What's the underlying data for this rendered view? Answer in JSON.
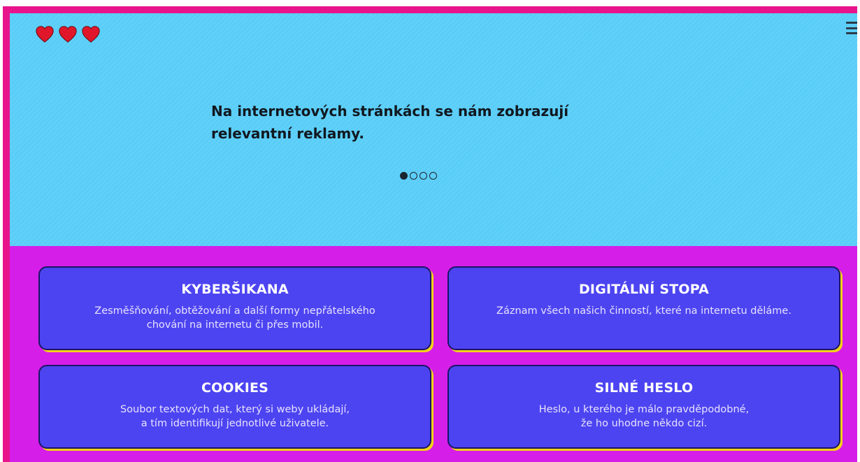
{
  "lives": [
    {
      "icon": "heart-icon",
      "color": "#e0172a"
    },
    {
      "icon": "heart-icon",
      "color": "#e0172a"
    },
    {
      "icon": "heart-icon",
      "color": "#e0172a"
    }
  ],
  "menu": {
    "icon": "hamburger-menu-icon"
  },
  "slide": {
    "lines": [
      "Na internetových stránkách se nám zobrazují",
      "relevantní reklamy."
    ],
    "current_index": 1,
    "total": 4
  },
  "cards": [
    {
      "title": "KYBERŠIKANA",
      "lines": [
        "Zesměšňování, obtěžování a další formy nepřátelského",
        "chování na internetu či přes mobil."
      ]
    },
    {
      "title": "DIGITÁLNÍ STOPA",
      "lines": [
        "Záznam všech našich činností, které na internetu děláme."
      ]
    },
    {
      "title": "COOKIES",
      "lines": [
        "Soubor textových dat, který si weby ukládají,",
        "a tím identifikují jednotlivé uživatele."
      ]
    },
    {
      "title": "SILNÉ HESLO",
      "lines": [
        "Heslo, u kterého je málo pravděpodobné,",
        "že ho uhodne někdo cizí."
      ]
    }
  ],
  "colors": {
    "frame": "#e8148c",
    "top_panel": "#58cdf7",
    "bottom_panel": "#d51ee8",
    "card": "#4d44f1",
    "card_shadow": "#f2d21a",
    "heart": "#e0172a"
  }
}
